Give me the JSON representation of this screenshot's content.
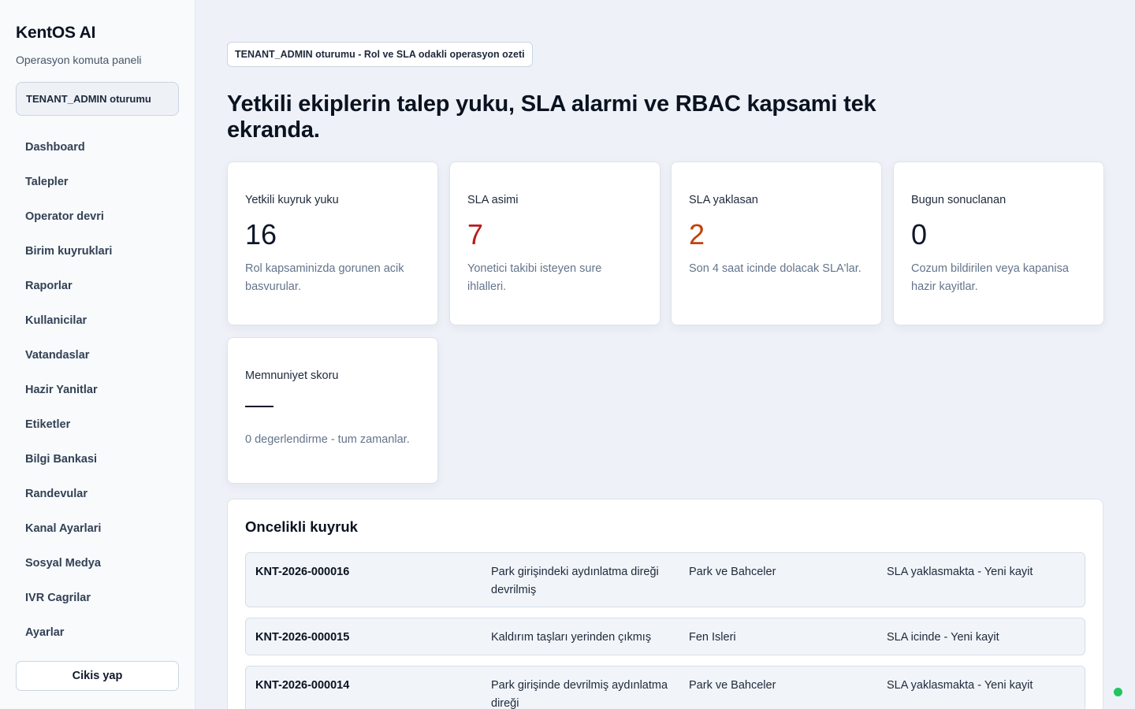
{
  "app": {
    "title": "KentOS AI",
    "subtitle": "Operasyon komuta paneli"
  },
  "sidebar": {
    "session": "TENANT_ADMIN oturumu",
    "items": [
      {
        "label": "Dashboard"
      },
      {
        "label": "Talepler"
      },
      {
        "label": "Operator devri"
      },
      {
        "label": "Birim kuyruklari"
      },
      {
        "label": "Raporlar"
      },
      {
        "label": "Kullanicilar"
      },
      {
        "label": "Vatandaslar"
      },
      {
        "label": "Hazir Yanitlar"
      },
      {
        "label": "Etiketler"
      },
      {
        "label": "Bilgi Bankasi"
      },
      {
        "label": "Randevular"
      },
      {
        "label": "Kanal Ayarlari"
      },
      {
        "label": "Sosyal Medya"
      },
      {
        "label": "IVR Cagrilar"
      },
      {
        "label": "Ayarlar"
      }
    ],
    "logout_label": "Cikis yap"
  },
  "header": {
    "chip": "TENANT_ADMIN oturumu - Rol ve SLA odakli operasyon ozeti",
    "headline": "Yetkili ekiplerin talep yuku, SLA alarmi ve RBAC kapsami tek ekranda."
  },
  "stats": [
    {
      "label": "Yetkili kuyruk yuku",
      "value": "16",
      "color": "#0f172a",
      "description": "Rol kapsaminizda gorunen acik basvurular."
    },
    {
      "label": "SLA asimi",
      "value": "7",
      "color": "#b91c1c",
      "description": "Yonetici takibi isteyen sure ihlalleri."
    },
    {
      "label": "SLA yaklasan",
      "value": "2",
      "color": "#c2410c",
      "description": "Son 4 saat icinde dolacak SLA'lar."
    },
    {
      "label": "Bugun sonuclanan",
      "value": "0",
      "color": "#0f172a",
      "description": "Cozum bildirilen veya kapanisa hazir kayitlar."
    }
  ],
  "satisfaction": {
    "label": "Memnuniyet skoru",
    "description": "0 degerlendirme - tum zamanlar."
  },
  "queue": {
    "title": "Oncelikli kuyruk",
    "rows": [
      {
        "id": "KNT-2026-000016",
        "title": "Park girişindeki aydınlatma direği devrilmiş",
        "department": "Park ve Bahceler",
        "status": "SLA yaklasmakta - Yeni kayit"
      },
      {
        "id": "KNT-2026-000015",
        "title": "Kaldırım taşları yerinden çıkmış",
        "department": "Fen Isleri",
        "status": "SLA icinde - Yeni kayit"
      },
      {
        "id": "KNT-2026-000014",
        "title": "Park girişinde devrilmiş aydınlatma direği",
        "department": "Park ve Bahceler",
        "status": "SLA yaklasmakta - Yeni kayit"
      }
    ]
  },
  "accent": {
    "online_dot": "#22c55e"
  }
}
